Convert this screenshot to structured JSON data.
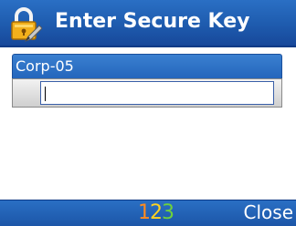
{
  "dialog": {
    "title": "Enter Secure Key",
    "icon": "lock-pen-icon"
  },
  "field": {
    "label": "Corp-05",
    "value": ""
  },
  "softkeys": {
    "input_mode": {
      "digit1": "1",
      "digit2": "2",
      "digit3": "3"
    },
    "right_label": "Close"
  },
  "colors": {
    "bar_blue": "#1f5db0",
    "mode_1": "#ff8a1f",
    "mode_2": "#ffd21f",
    "mode_3": "#6ed23a"
  }
}
